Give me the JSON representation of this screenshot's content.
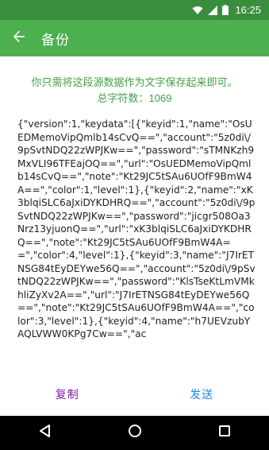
{
  "status_bar": {
    "time": "16:25",
    "icons": [
      "wifi-icon",
      "cellular-signal-icon",
      "battery-icon"
    ]
  },
  "app_bar": {
    "title": "备份",
    "back_icon": "arrow-back-icon"
  },
  "hint": {
    "instruction": "你只需将这段源数据作为文字保存起来即可。",
    "char_count": "总字符数：1069"
  },
  "backup_text": "{\"version\":1,\"keydata\":[{\"keyid\":1,\"name\":\"OsUEDMemoVipQmlb14sCvQ==\",\"account\":\"5z0di\\/9pSvtNDQ22zWPJKw==\",\"password\":\"sTMNKzh9MxVLI96TFEajOQ==\",\"url\":\"OsUEDMemoVipQmlb14sCvQ==\",\"note\":\"Kt29JC5tSAu6UOfF9BmW4A==\",\"color\":1,\"level\":1},{\"keyid\":2,\"name\":\"xK3blqiSLC6aJxiDYKDHRQ==\",\"account\":\"5z0di\\/9pSvtNDQ22zWPJKw==\",\"password\":\"jicgr508Oa3Nrz13yjuonQ==\",\"url\":\"xK3blqiSLC6aJxiDYKDHRQ==\",\"note\":\"Kt29JC5tSAu6UOfF9BmW4A==\",\"color\":4,\"level\":1},{\"keyid\":3,\"name\":\"J7IrETNSG84tEyDEYwe56Q==\",\"account\":\"5z0di\\/9pSvtNDQ22zWPJKw==\",\"password\":\"KlsTseKtLmVMkhliZyXv2A==\",\"url\":\"J7IrETNSG84tEyDEYwe56Q==\",\"note\":\"Kt29JC5tSAu6UOfF9BmW4A==\",\"color\":3,\"level\":1},{\"keyid\":4,\"name\":\"h7UEVzubYAQLVWW0KPg7Cw==\",\"ac",
  "actions": {
    "copy_label": "复制",
    "send_label": "发送"
  },
  "nav_bar": {
    "icons": [
      "back-triangle-icon",
      "home-circle-icon",
      "recents-square-icon"
    ]
  },
  "colors": {
    "status_bar": "#388e3c",
    "app_bar": "#4caf50",
    "hint_text": "#43a047",
    "copy": "#7b1fa2",
    "send": "#1e88e5"
  }
}
